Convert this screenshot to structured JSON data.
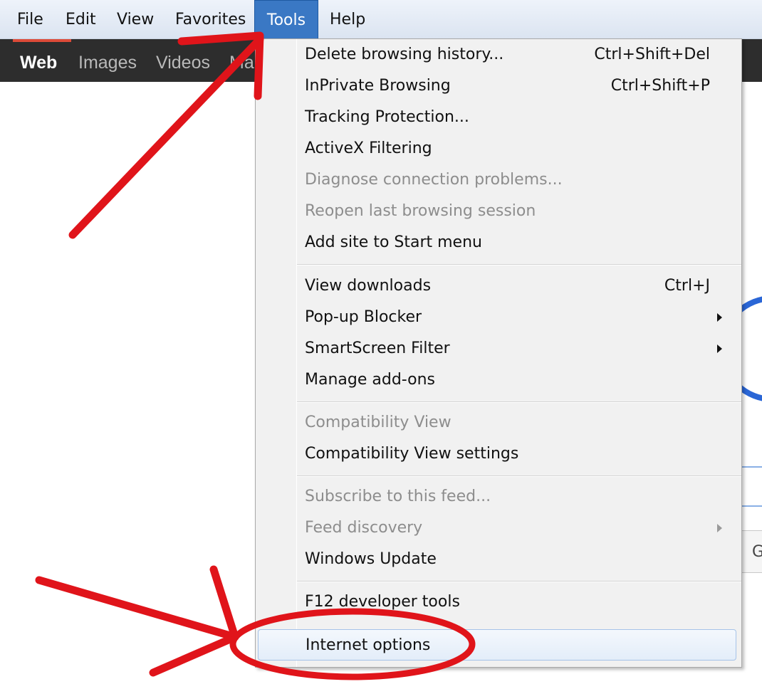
{
  "menubar": {
    "items": [
      {
        "label": "File"
      },
      {
        "label": "Edit"
      },
      {
        "label": "View"
      },
      {
        "label": "Favorites"
      },
      {
        "label": "Tools",
        "active": true
      },
      {
        "label": "Help"
      }
    ]
  },
  "navbar": {
    "items": [
      {
        "label": "Web",
        "active": true
      },
      {
        "label": "Images"
      },
      {
        "label": "Videos"
      },
      {
        "label": "Ma"
      }
    ]
  },
  "background": {
    "button_label": "G"
  },
  "tools_menu": {
    "items": [
      {
        "label": "Delete browsing history...",
        "shortcut": "Ctrl+Shift+Del"
      },
      {
        "label": "InPrivate Browsing",
        "shortcut": "Ctrl+Shift+P"
      },
      {
        "label": "Tracking Protection..."
      },
      {
        "label": "ActiveX Filtering"
      },
      {
        "label": "Diagnose connection problems...",
        "disabled": true
      },
      {
        "label": "Reopen last browsing session",
        "disabled": true
      },
      {
        "label": "Add site to Start menu"
      },
      {
        "label": "View downloads",
        "shortcut": "Ctrl+J"
      },
      {
        "label": "Pop-up Blocker",
        "submenu": true
      },
      {
        "label": "SmartScreen Filter",
        "submenu": true
      },
      {
        "label": "Manage add-ons"
      },
      {
        "label": "Compatibility View",
        "disabled": true
      },
      {
        "label": "Compatibility View settings"
      },
      {
        "label": "Subscribe to this feed...",
        "disabled": true
      },
      {
        "label": "Feed discovery",
        "disabled": true,
        "submenu": true
      },
      {
        "label": "Windows Update"
      },
      {
        "label": "F12 developer tools"
      },
      {
        "label": "Internet options",
        "highlighted": true
      }
    ]
  },
  "colors": {
    "annotation": "#e0141a",
    "menu_active": "#3a78c4",
    "hover_border": "#a6c3e8"
  }
}
